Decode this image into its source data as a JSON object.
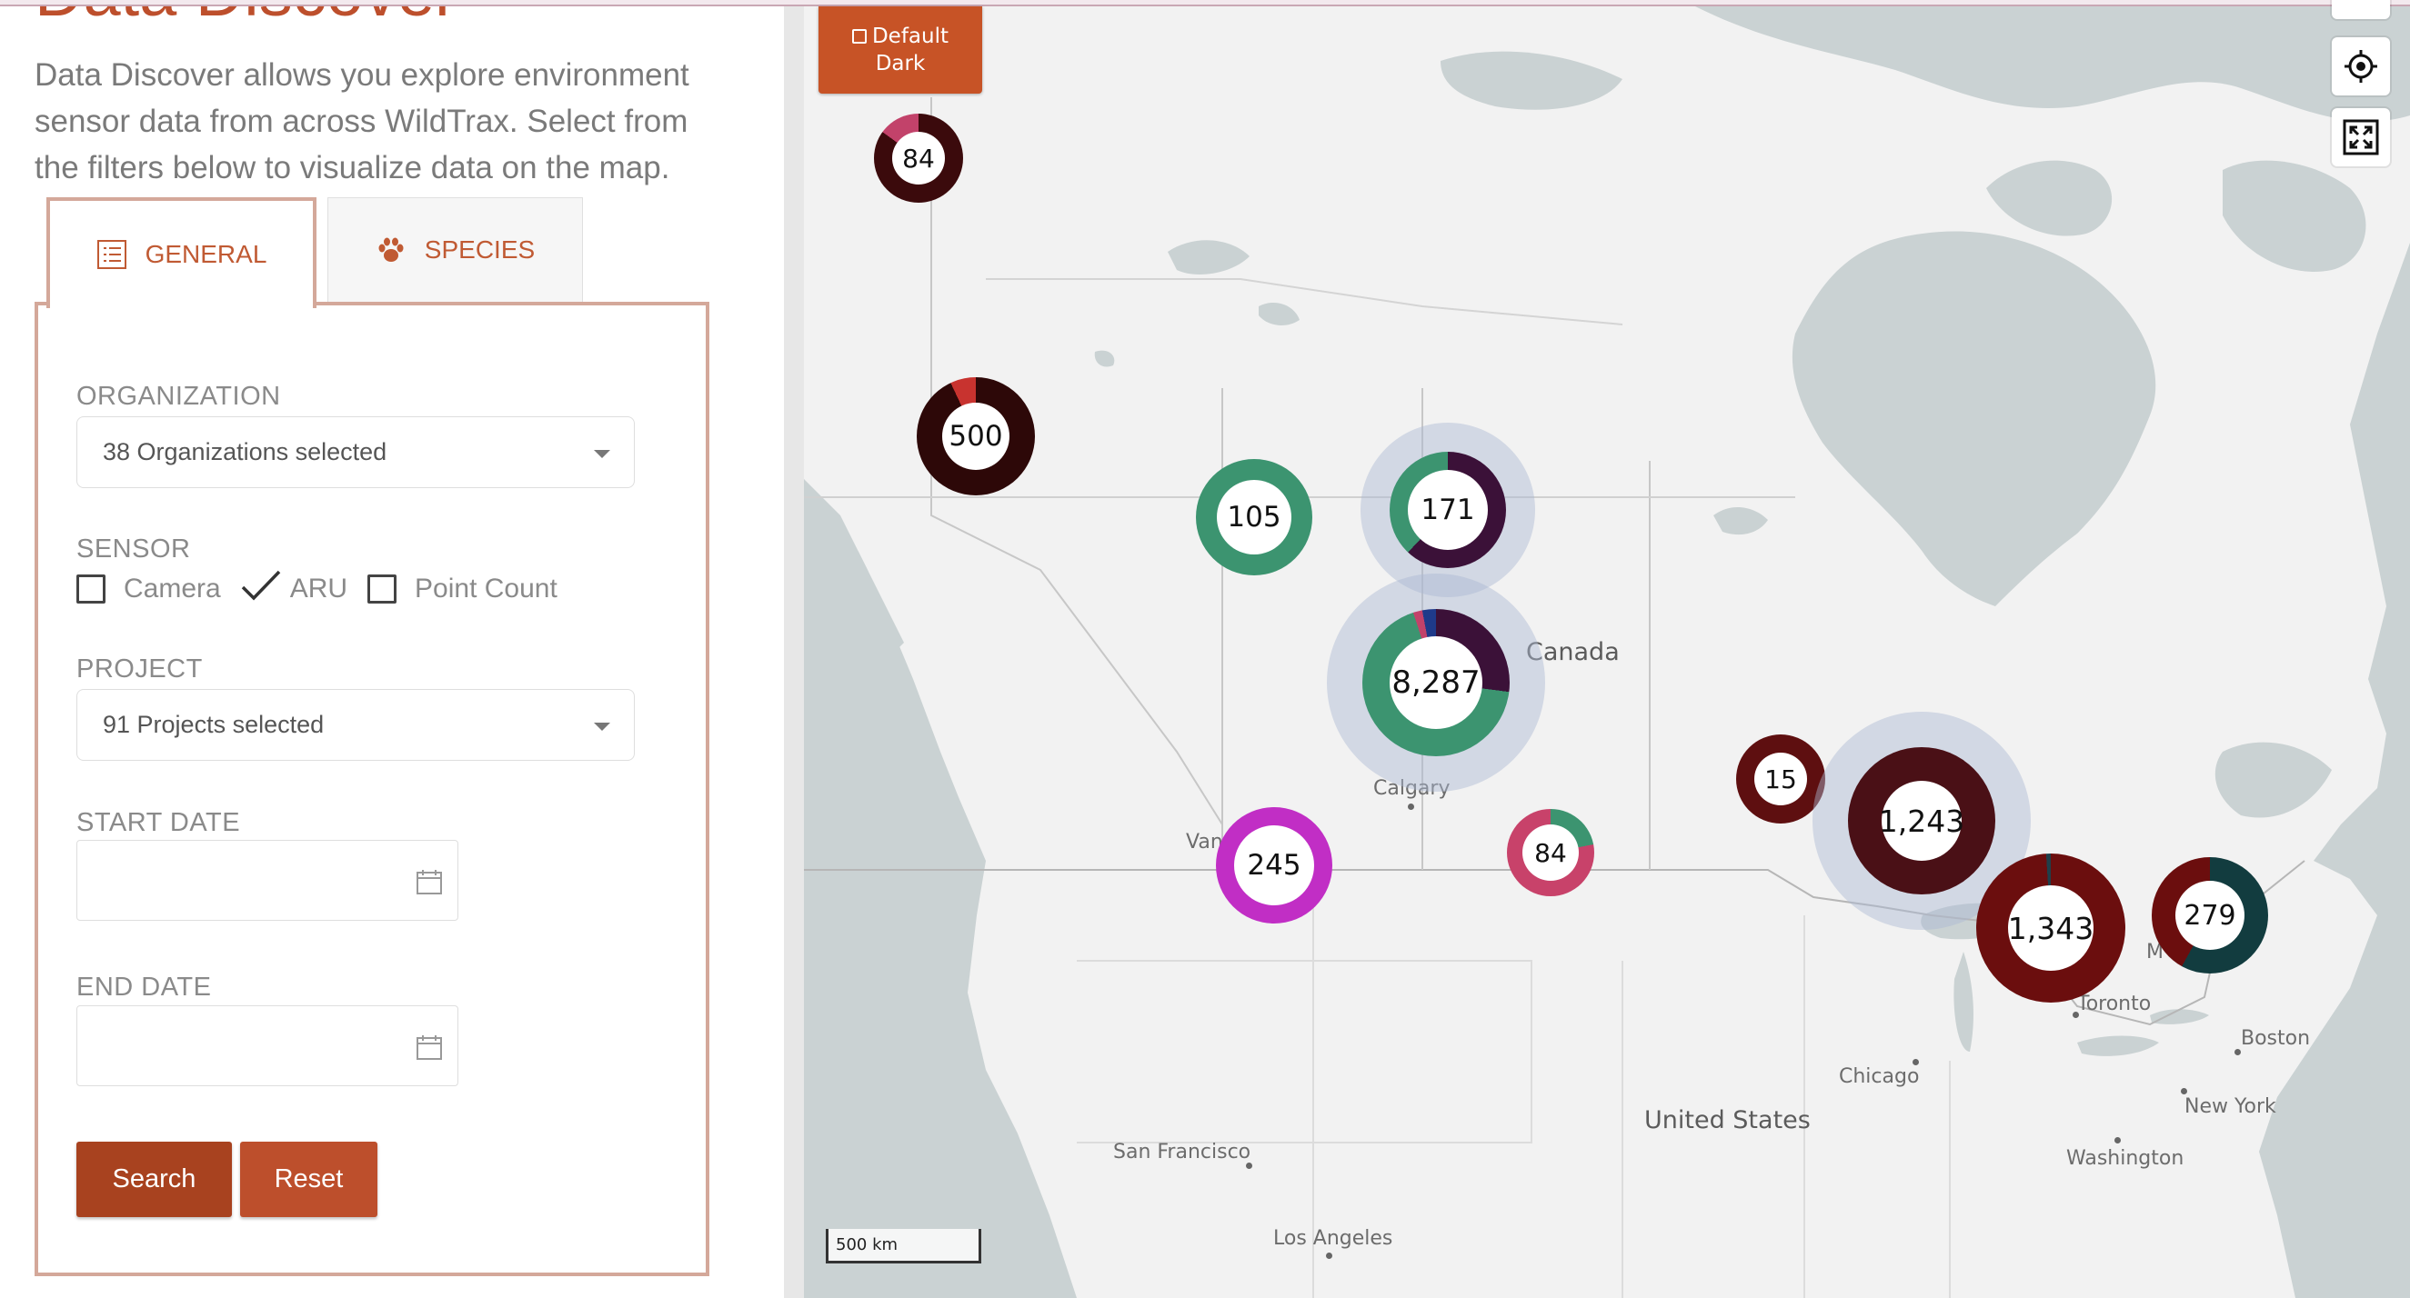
{
  "page": {
    "title": "Data Discover",
    "intro": "Data Discover allows you explore environment sensor data from across WildTrax. Select from the filters below to visualize data on the map."
  },
  "tabs": {
    "general": "GENERAL",
    "species": "SPECIES"
  },
  "filters": {
    "organization": {
      "label": "ORGANIZATION",
      "value": "38 Organizations selected"
    },
    "sensor": {
      "label": "SENSOR",
      "options": [
        {
          "label": "Camera",
          "checked": false
        },
        {
          "label": "ARU",
          "checked": true
        },
        {
          "label": "Point Count",
          "checked": false
        }
      ]
    },
    "project": {
      "label": "PROJECT",
      "value": "91 Projects selected"
    },
    "start_date": {
      "label": "START DATE",
      "value": ""
    },
    "end_date": {
      "label": "END DATE",
      "value": ""
    },
    "search_label": "Search",
    "reset_label": "Reset"
  },
  "map": {
    "style_toggle": {
      "line1": "Default",
      "line2": "Dark"
    },
    "scale_label": "500 km",
    "icons": {
      "locate": "crosshair-icon",
      "fullscreen": "expand-icon",
      "style": "checkbox-icon",
      "date": "calendar-icon",
      "general": "list-icon",
      "species": "paw-icon"
    },
    "colors": {
      "land": "#f2f2f2",
      "water": "#cad2d3",
      "accent": "#bd4f2c"
    },
    "labels": {
      "canada": "Canada",
      "united_states": "United States",
      "calgary": "Calgary",
      "vancouver": "Van",
      "toronto": "Toronto",
      "chicago": "Chicago",
      "boston": "Boston",
      "new_york": "New York",
      "washington": "Washington",
      "san_francisco": "San Francisco",
      "los_angeles": "Los Angeles",
      "montreal": "M"
    },
    "clusters": [
      {
        "label": "84",
        "segments": [
          [
            "#3b0a0c",
            0.85
          ],
          [
            "#c2426a",
            0.15
          ]
        ]
      },
      {
        "label": "500",
        "segments": [
          [
            "#2d0808",
            0.93
          ],
          [
            "#c8332f",
            0.07
          ]
        ]
      },
      {
        "label": "105",
        "segments": [
          [
            "#3c9470",
            1.0
          ]
        ]
      },
      {
        "label": "171",
        "segments": [
          [
            "#3b1138",
            0.62
          ],
          [
            "#3c9470",
            0.38
          ]
        ]
      },
      {
        "label": "8,287",
        "segments": [
          [
            "#3b1138",
            0.27
          ],
          [
            "#3c9470",
            0.68
          ],
          [
            "#c2426a",
            0.02
          ],
          [
            "#1f3a8a",
            0.03
          ]
        ]
      },
      {
        "label": "245",
        "segments": [
          [
            "#c12ec5",
            1.0
          ]
        ]
      },
      {
        "label": "84",
        "segments": [
          [
            "#3c9470",
            0.22
          ],
          [
            "#c8426a",
            0.78
          ]
        ]
      },
      {
        "label": "15",
        "segments": [
          [
            "#5e0f10",
            1.0
          ]
        ]
      },
      {
        "label": "1,243",
        "segments": [
          [
            "#4a1016",
            1.0
          ]
        ]
      },
      {
        "label": "1,343",
        "segments": [
          [
            "#6b0e0e",
            0.99
          ],
          [
            "#1f3f4a",
            0.01
          ]
        ]
      },
      {
        "label": "279",
        "segments": [
          [
            "#123c3f",
            0.58
          ],
          [
            "#6b0e0e",
            0.42
          ]
        ]
      }
    ]
  }
}
